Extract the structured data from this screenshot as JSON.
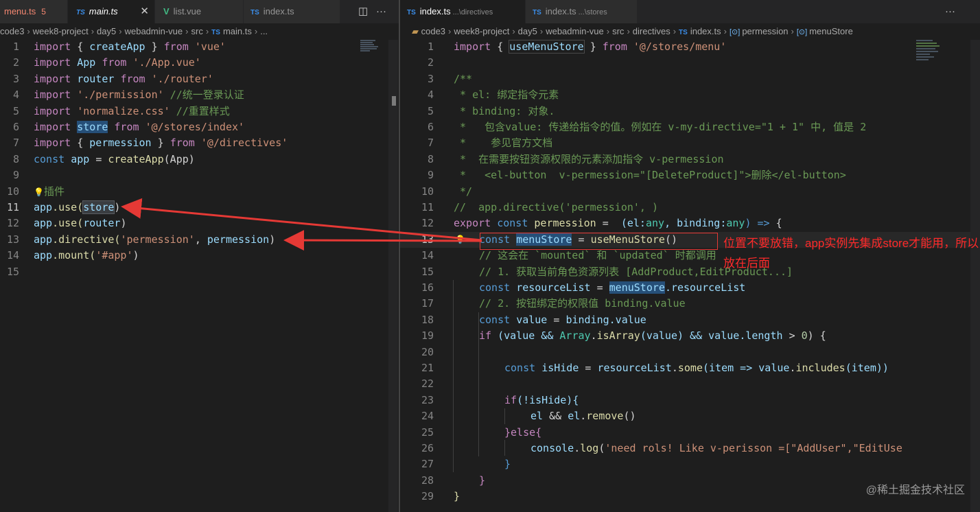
{
  "left_tabs": [
    {
      "icon": "",
      "label": "menu.ts",
      "badge": "5"
    },
    {
      "icon": "TS",
      "label": "main.ts",
      "close": "✕"
    },
    {
      "icon": "V",
      "label": "list.vue"
    },
    {
      "icon": "TS",
      "label": "index.ts"
    }
  ],
  "right_tabs": [
    {
      "icon": "TS",
      "label": "index.ts",
      "sub": "...\\directives"
    },
    {
      "icon": "TS",
      "label": "index.ts",
      "sub": "...\\stores"
    }
  ],
  "actions": {
    "split": "◫",
    "more": "···"
  },
  "left_breadcrumb": [
    "code3",
    "week8-project",
    "day5",
    "webadmin-vue",
    "src",
    "main.ts",
    "..."
  ],
  "right_breadcrumb": [
    "code3",
    "week8-project",
    "day5",
    "webadmin-vue",
    "src",
    "directives",
    "index.ts",
    "permession",
    "menuStore"
  ],
  "left_code": {
    "n": [
      "1",
      "2",
      "3",
      "4",
      "5",
      "6",
      "7",
      "8",
      "9",
      "10",
      "11",
      "12",
      "13",
      "14",
      "15"
    ],
    "l1": [
      "import",
      "{",
      "createApp",
      "}",
      "from",
      "'vue'"
    ],
    "l2": [
      "import",
      "App",
      "from",
      "'./App.vue'"
    ],
    "l3": [
      "import",
      "router",
      "from",
      "'./router'"
    ],
    "l4": [
      "import",
      "'./permission'",
      "//统一登录认证"
    ],
    "l5": [
      "import",
      "'normalize.css'",
      "//重置样式"
    ],
    "l6": [
      "import",
      "store",
      "from",
      "'@/stores/index'"
    ],
    "l7": [
      "import",
      "{",
      "permession",
      "}",
      "from",
      "'@/directives'"
    ],
    "l8": [
      "const",
      "app",
      "=",
      "createApp",
      "(App)"
    ],
    "l10": [
      "💡",
      "插件"
    ],
    "l11": [
      "app",
      ".use(",
      "store",
      ")"
    ],
    "l12": [
      "app",
      ".use(",
      "router",
      ")"
    ],
    "l13": [
      "app",
      ".directive(",
      "'permession'",
      ", ",
      "permession",
      ")"
    ],
    "l14": [
      "app",
      ".mount(",
      "'#app'",
      ")"
    ]
  },
  "right_code": {
    "n": [
      "1",
      "2",
      "3",
      "4",
      "5",
      "6",
      "7",
      "8",
      "9",
      "10",
      "11",
      "12",
      "13",
      "14",
      "15",
      "16",
      "17",
      "18",
      "19",
      "20",
      "21",
      "22",
      "23",
      "24",
      "25",
      "26",
      "27",
      "28",
      "29"
    ],
    "l1": [
      "import",
      "{",
      "useMenuStore",
      "}",
      "from",
      "'@/stores/menu'"
    ],
    "l3": "/**",
    "l4": " * el: 绑定指令元素",
    "l5": " * binding: 对象.",
    "l6": " *   包含value: 传递给指令的值。例如在 v-my-directive=\"1 + 1\" 中, 值是 2",
    "l7": " *    参见官方文档",
    "l8": " *  在需要按钮资源权限的元素添加指令 v-permession",
    "l9": " *   <el-button  v-permession=\"[DeleteProduct]\">删除</el-button>",
    "l10": " */",
    "l11": "//  app.directive('permession', )",
    "l12": [
      "export",
      "const",
      "permession",
      "=",
      "(el:",
      "any",
      ", binding:",
      "any",
      ") =>",
      "{"
    ],
    "l13": [
      "const",
      "menuStore",
      "=",
      "useMenuStore",
      "()"
    ],
    "l14": "// 这会在 `mounted` 和 `updated` 时都调用",
    "l15": "// 1. 获取当前角色资源列表 [AddProduct,EditProduct...]",
    "l16": [
      "const",
      "resourceList",
      "=",
      "menuStore",
      ".resourceList"
    ],
    "l17": "// 2. 按钮绑定的权限值 binding.value",
    "l18": [
      "const",
      "value",
      "=",
      "binding",
      ".value"
    ],
    "l19": [
      "if",
      "(value &&",
      "Array",
      ".",
      "isArray",
      "(value) &&",
      "value",
      ".length",
      ">",
      "0",
      ") {"
    ],
    "l21": [
      "const",
      "isHide",
      "=",
      "resourceList",
      ".",
      "some",
      "(item =>",
      "value",
      ".",
      "includes",
      "(item))"
    ],
    "l23": [
      "if",
      "(!isHide){"
    ],
    "l24": [
      "el",
      "&&",
      "el",
      ".",
      "remove",
      "()"
    ],
    "l25": [
      "}else{"
    ],
    "l26": [
      "console",
      ".",
      "log",
      "(",
      "'need rols! Like v-perisson =[\"AddUser\",\"EditUse"
    ],
    "l27": "}",
    "l28": "}",
    "l29": "}"
  },
  "annotation": {
    "note": "位置不要放错，app实例先集成store才能用，所以放在后面",
    "color": "#ff2a2a"
  },
  "watermark": "@稀土掘金技术社区",
  "colors": {
    "keyword": "#569cd6",
    "control": "#c586c0",
    "function": "#dcdcaa",
    "variable": "#9cdcfe",
    "string": "#ce9178",
    "comment": "#6a9955",
    "type": "#4ec9b0",
    "number": "#b5cea8"
  }
}
